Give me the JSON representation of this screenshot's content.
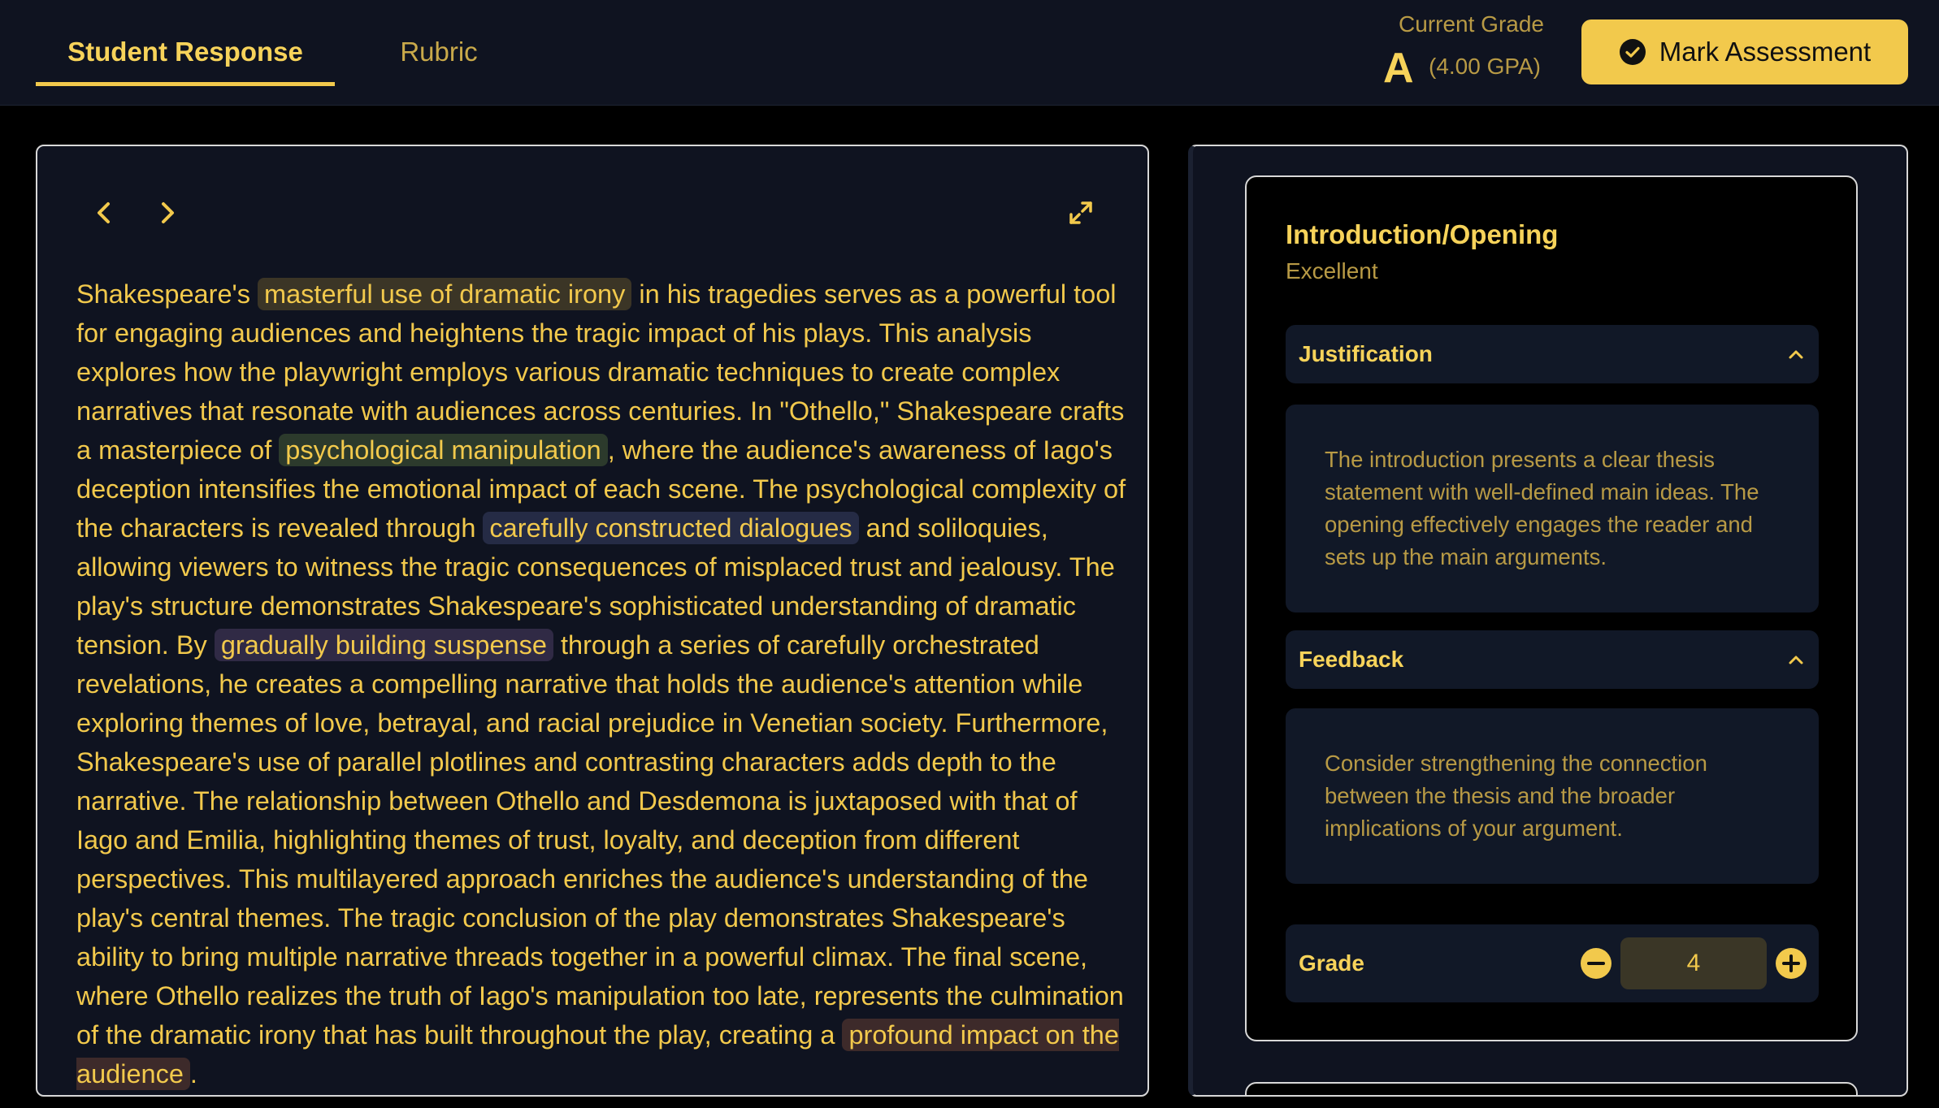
{
  "tabs": {
    "student_response": "Student Response",
    "rubric": "Rubric"
  },
  "grade_summary": {
    "label": "Current Grade",
    "letter": "A",
    "gpa": "(4.00 GPA)"
  },
  "mark_button": {
    "label": "Mark Assessment",
    "icon": "check-circle-icon"
  },
  "essay": {
    "seg1": "Shakespeare's ",
    "hl1": "masterful use of dramatic irony",
    "seg2": " in his tragedies serves as a powerful tool for engaging audiences and heightens the tragic impact of his plays. This analysis explores how the playwright employs various dramatic techniques to create complex narratives that resonate with audiences across centuries. In \"Othello,\" Shakespeare crafts a masterpiece of ",
    "hl2": "psychological manipulation",
    "seg3": ", where the audience's awareness of Iago's deception intensifies the emotional impact of each scene. The psychological complexity of the characters is revealed through ",
    "hl3": "carefully constructed dialogues",
    "seg4": " and soliloquies, allowing viewers to witness the tragic consequences of misplaced trust and jealousy. The play's structure demonstrates Shakespeare's sophisticated understanding of dramatic tension. By ",
    "hl4": "gradually building suspense",
    "seg5": " through a series of carefully orchestrated revelations, he creates a compelling narrative that holds the audience's attention while exploring themes of love, betrayal, and racial prejudice in Venetian society. Furthermore, Shakespeare's use of parallel plotlines and contrasting characters adds depth to the narrative. The relationship between Othello and Desdemona is juxtaposed with that of Iago and Emilia, highlighting themes of trust, loyalty, and deception from different perspectives. This multilayered approach enriches the audience's understanding of the play's central themes. The tragic conclusion of the play demonstrates Shakespeare's ability to bring multiple narrative threads together in a powerful climax. The final scene, where Othello realizes the truth of Iago's manipulation too late, represents the culmination of the dramatic irony that has built throughout the play, creating a ",
    "hl5": "profound impact on the audience",
    "seg6": "."
  },
  "criterion": {
    "title": "Introduction/Opening",
    "level": "Excellent",
    "justification_label": "Justification",
    "justification_text": "The introduction presents a clear thesis statement with well-defined main ideas. The opening effectively engages the reader and sets up the main arguments.",
    "feedback_label": "Feedback",
    "feedback_text": "Consider strengthening the connection between the thesis and the broader implications of your argument.",
    "grade_label": "Grade",
    "grade_value": "4"
  },
  "colors": {
    "accent": "#f2c94c",
    "panel_bg": "#0f1320",
    "section_bg": "#111827",
    "highlight_brown": "#3b3526",
    "highlight_green": "#2c3a2c",
    "highlight_blue": "#252b45",
    "highlight_purple": "#302a45",
    "highlight_red": "#3d2a2a"
  }
}
